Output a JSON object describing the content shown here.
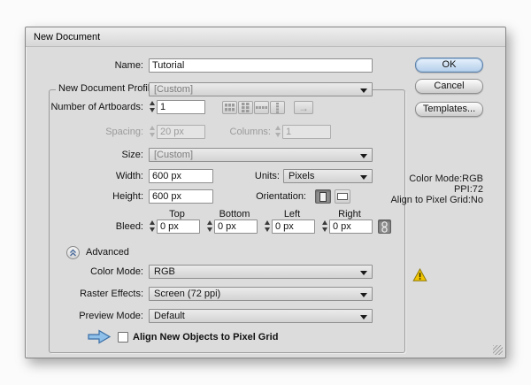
{
  "window": {
    "title": "New Document"
  },
  "buttons": {
    "ok": "OK",
    "cancel": "Cancel",
    "templates": "Templates..."
  },
  "name_row": {
    "label": "Name:",
    "value": "Tutorial"
  },
  "profile_row": {
    "label": "New Document Profile:",
    "value": "[Custom]"
  },
  "artboards_row": {
    "label": "Number of Artboards:",
    "value": "1"
  },
  "spacing_row": {
    "label": "Spacing:",
    "value": "20 px"
  },
  "columns_row": {
    "label": "Columns:",
    "value": "1"
  },
  "size_row": {
    "label": "Size:",
    "value": "[Custom]"
  },
  "width_row": {
    "label": "Width:",
    "value": "600 px"
  },
  "units_row": {
    "label": "Units:",
    "value": "Pixels"
  },
  "height_row": {
    "label": "Height:",
    "value": "600 px"
  },
  "orientation_row": {
    "label": "Orientation:"
  },
  "bleed_row": {
    "label": "Bleed:",
    "columns": [
      {
        "label": "Top",
        "value": "0 px"
      },
      {
        "label": "Bottom",
        "value": "0 px"
      },
      {
        "label": "Left",
        "value": "0 px"
      },
      {
        "label": "Right",
        "value": "0 px"
      }
    ]
  },
  "advanced": {
    "label": "Advanced"
  },
  "color_mode_row": {
    "label": "Color Mode:",
    "value": "RGB"
  },
  "raster_row": {
    "label": "Raster Effects:",
    "value": "Screen (72 ppi)"
  },
  "preview_row": {
    "label": "Preview Mode:",
    "value": "Default"
  },
  "align_row": {
    "label": "Align New Objects to Pixel Grid",
    "checked": false
  },
  "info_panel": {
    "lines": [
      "Color Mode:RGB",
      "PPI:72",
      "Align to Pixel Grid:No"
    ]
  },
  "colors": {
    "dialog_bg": "#dcdcdc",
    "ok_button": "#cfe2f5",
    "warning_yellow": "#f2c500",
    "pixel_grid_arrow_blue": "#8fc0ea"
  }
}
